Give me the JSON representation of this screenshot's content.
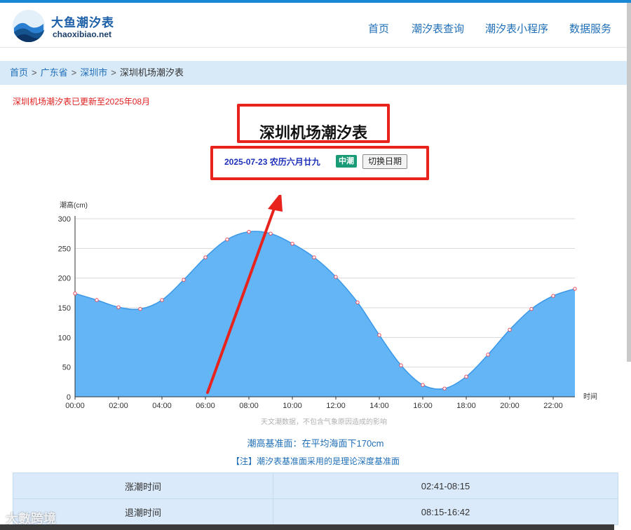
{
  "logo": {
    "title": "大鱼潮汐表",
    "domain": "chaoxibiao.net"
  },
  "nav": [
    "首页",
    "潮汐表查询",
    "潮汐表小程序",
    "数据服务"
  ],
  "breadcrumb": {
    "home": "首页",
    "province": "广东省",
    "city": "深圳市",
    "current": "深圳机场潮汐表",
    "separator": ">"
  },
  "notice": "深圳机场潮汐表已更新至2025年08月",
  "page_title": "深圳机场潮汐表",
  "date_info": {
    "date": "2025-07-23",
    "lunar": "农历六月廿九",
    "tide_badge": "中潮",
    "switch_label": "切换日期"
  },
  "chart_data": {
    "type": "area",
    "ylabel": "潮高(cm)",
    "xlabel": "时间",
    "x": [
      "00:00",
      "01:00",
      "02:00",
      "03:00",
      "04:00",
      "05:00",
      "06:00",
      "07:00",
      "08:00",
      "09:00",
      "10:00",
      "11:00",
      "12:00",
      "13:00",
      "14:00",
      "15:00",
      "16:00",
      "17:00",
      "18:00",
      "19:00",
      "20:00",
      "21:00",
      "22:00",
      "23:00"
    ],
    "x_tick_labels": [
      "00:00",
      "02:00",
      "04:00",
      "06:00",
      "08:00",
      "10:00",
      "12:00",
      "14:00",
      "16:00",
      "18:00",
      "20:00",
      "22:00"
    ],
    "series": [
      {
        "values": [
          174,
          163,
          151,
          148,
          163,
          197,
          235,
          265,
          278,
          275,
          258,
          235,
          202,
          159,
          104,
          53,
          20,
          14,
          34,
          71,
          113,
          148,
          170,
          182
        ]
      }
    ],
    "ylim": [
      0,
      300
    ],
    "yticks": [
      0,
      50,
      100,
      150,
      200,
      250,
      300
    ],
    "grid": true,
    "caption": "天文潮数据，不包含气象原因造成的影响",
    "fill_color": "#64b5f6",
    "line_color": "#3a98e8",
    "marker_color": "#e84b5a"
  },
  "datum": "潮高基准面：在平均海面下170cm",
  "note": "【注】潮汐表基准面采用的是理论深度基准面",
  "tide_table": [
    {
      "label": "涨潮时间",
      "value": "02:41-08:15"
    },
    {
      "label": "退潮时间",
      "value": "08:15-16:42"
    }
  ],
  "watermark": "大數跨境"
}
